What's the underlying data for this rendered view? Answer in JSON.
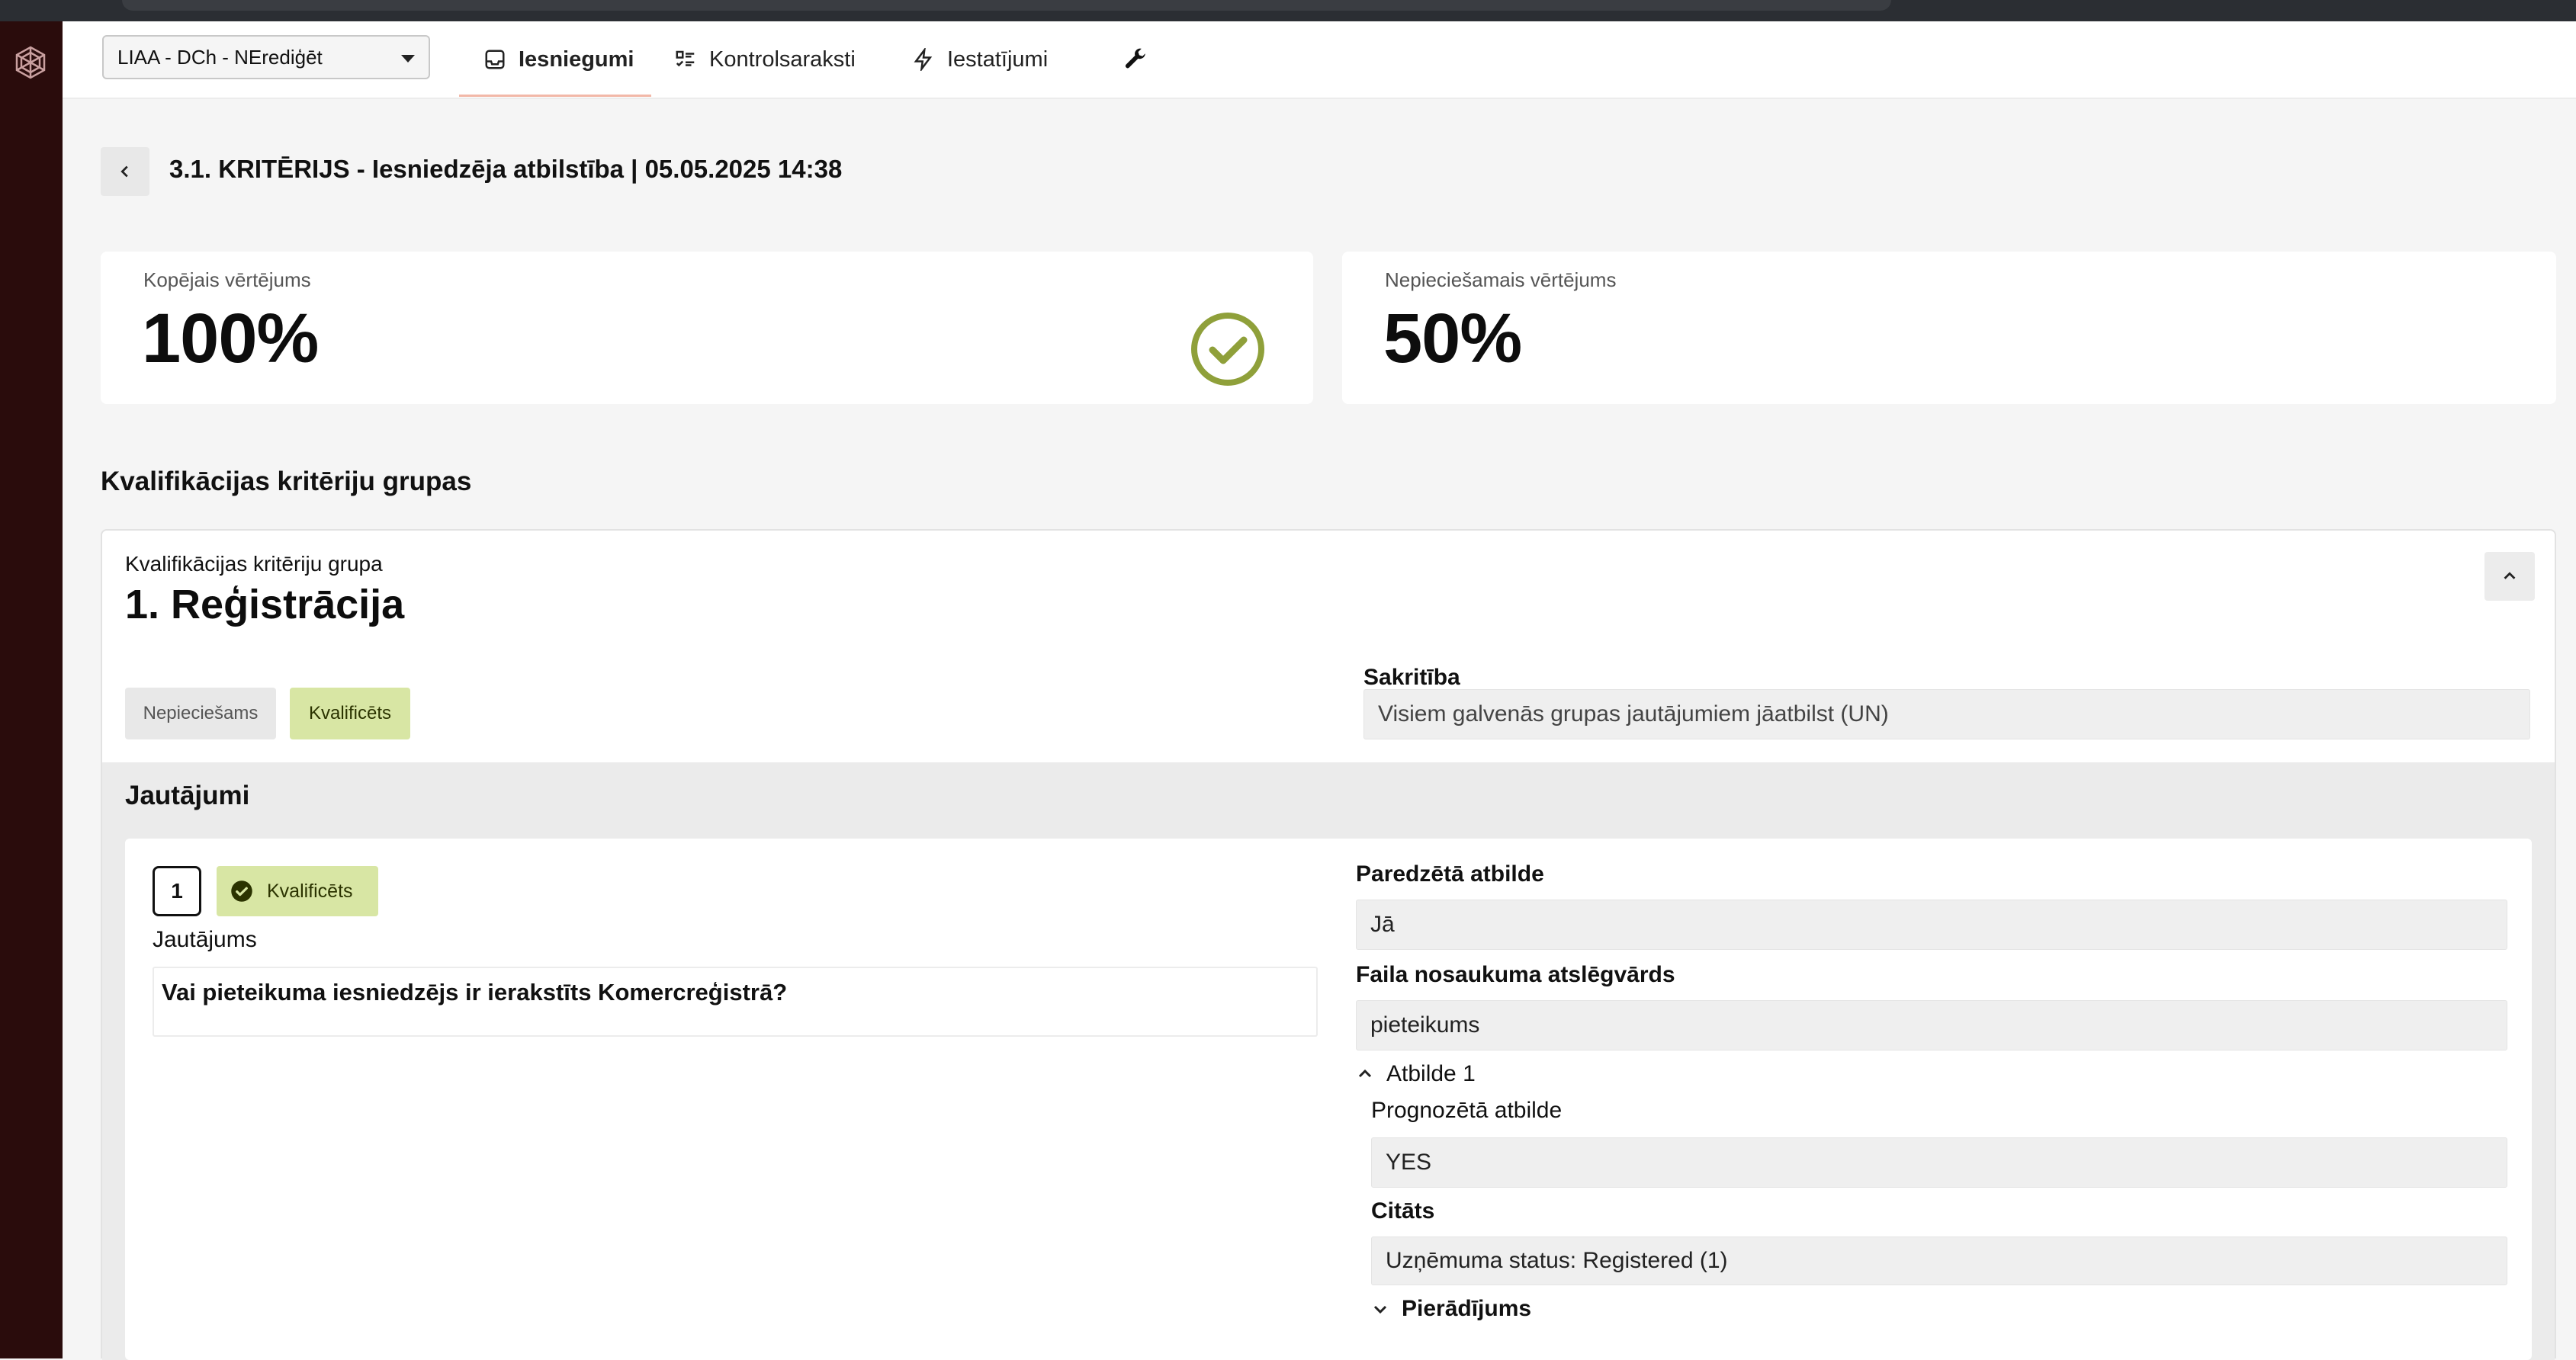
{
  "colors": {
    "sidebar": "#2a0c0c",
    "accent_green": "#8fa03a",
    "qualified_bg": "#d8e6a4"
  },
  "nav": {
    "workspace_select": "LIAA - DCh - NErediģēt",
    "tabs": [
      {
        "label": "Iesniegumi",
        "icon": "inbox-icon",
        "active": true
      },
      {
        "label": "Kontrolsaraksti",
        "icon": "checklist-icon",
        "active": false
      },
      {
        "label": "Iestatījumi",
        "icon": "lightning-icon",
        "active": false
      }
    ],
    "tools_icon": "wrench-icon"
  },
  "header": {
    "title": "3.1. KRITĒRIJS - Iesniedzēja atbilstība | 05.05.2025 14:38"
  },
  "scores": {
    "overall": {
      "label": "Kopējais vērtējums",
      "value": "100%",
      "status_icon": "check-circle-icon"
    },
    "required": {
      "label": "Nepieciešamais vērtējums",
      "value": "50%"
    }
  },
  "groups_section": {
    "title": "Kvalifikācijas kritēriju grupas",
    "group": {
      "caption": "Kvalifikācijas kritēriju grupa",
      "name": "1. Reģistrācija",
      "tags": [
        "Nepieciešams",
        "Kvalificēts"
      ],
      "match_label": "Sakritība",
      "match_value": "Visiem galvenās grupas jautājumiem jāatbilst (UN)"
    }
  },
  "questions": {
    "title": "Jautājumi",
    "items": [
      {
        "number": "1",
        "status": "Kvalificēts",
        "question_label": "Jautājums",
        "question_text": "Vai pieteikuma iesniedzējs ir ierakstīts Komercreģistrā?",
        "expected_label": "Paredzētā atbilde",
        "expected_value": "Jā",
        "keyword_label": "Faila nosaukuma atslēgvārds",
        "keyword_value": "pieteikums",
        "answer_toggle": "Atbilde 1",
        "predicted_label": "Prognozētā atbilde",
        "predicted_value": "YES",
        "quote_label": "Citāts",
        "quote_value": "Uzņēmuma status: Registered (1)",
        "evidence_toggle": "Pierādījums"
      }
    ]
  }
}
